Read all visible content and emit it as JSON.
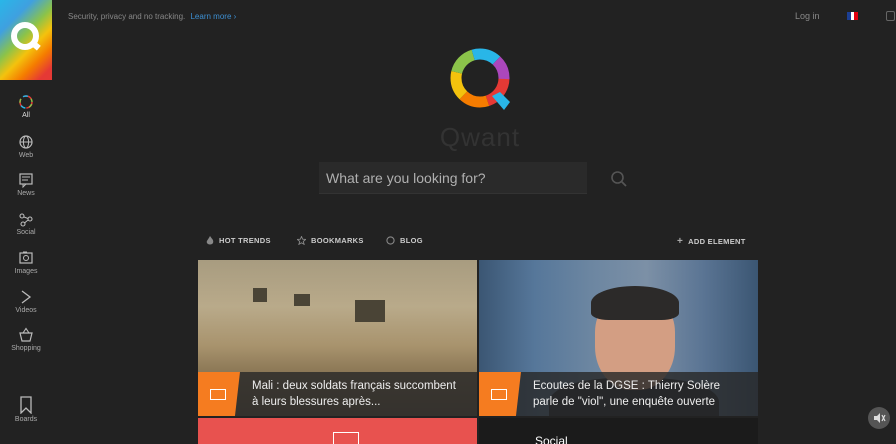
{
  "sidebar": {
    "items": [
      {
        "label": "All",
        "icon": "all-icon"
      },
      {
        "label": "Web",
        "icon": "globe-icon"
      },
      {
        "label": "News",
        "icon": "news-icon"
      },
      {
        "label": "Social",
        "icon": "social-icon"
      },
      {
        "label": "Images",
        "icon": "image-icon"
      },
      {
        "label": "Videos",
        "icon": "video-icon"
      },
      {
        "label": "Shopping",
        "icon": "shopping-icon"
      },
      {
        "label": "Boards",
        "icon": "bookmark-icon"
      }
    ]
  },
  "topbar": {
    "tagline": "Security, privacy and no tracking.",
    "learn_more": "Learn more",
    "login": "Log in",
    "flag_colors": [
      "#1c3f94",
      "#ffffff",
      "#e1000f"
    ]
  },
  "brand": {
    "name": "Qwant"
  },
  "search": {
    "placeholder": "What are you looking for?"
  },
  "tabs": {
    "hot_trends": "HOT TRENDS",
    "bookmarks": "BOOKMARKS",
    "blog": "BLOG",
    "add_element": "ADD ELEMENT"
  },
  "cards": [
    {
      "title": "Mali : deux soldats français succombent à leurs blessures après..."
    },
    {
      "title": "Ecoutes de la DGSE : Thierry Solère parle de \"viol\", une enquête ouverte"
    },
    {
      "title": ""
    },
    {
      "title": "Social"
    }
  ],
  "colors": {
    "accent": "#f57c20",
    "background": "#222222",
    "link": "#3d8fd1"
  }
}
